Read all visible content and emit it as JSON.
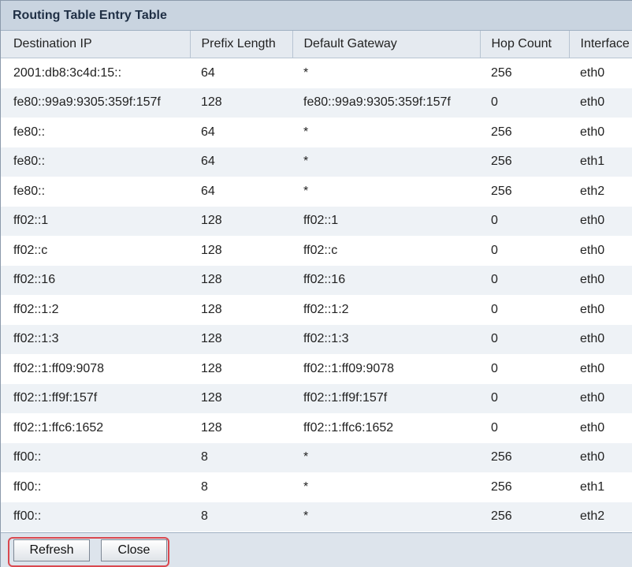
{
  "window": {
    "title": "Routing Table Entry Table"
  },
  "table": {
    "columns": [
      "Destination IP",
      "Prefix Length",
      "Default Gateway",
      "Hop Count",
      "Interface"
    ],
    "rows": [
      [
        "2001:db8:3c4d:15::",
        "64",
        "*",
        "256",
        "eth0"
      ],
      [
        "fe80::99a9:9305:359f:157f",
        "128",
        "fe80::99a9:9305:359f:157f",
        "0",
        "eth0"
      ],
      [
        "fe80::",
        "64",
        "*",
        "256",
        "eth0"
      ],
      [
        "fe80::",
        "64",
        "*",
        "256",
        "eth1"
      ],
      [
        "fe80::",
        "64",
        "*",
        "256",
        "eth2"
      ],
      [
        "ff02::1",
        "128",
        "ff02::1",
        "0",
        "eth0"
      ],
      [
        "ff02::c",
        "128",
        "ff02::c",
        "0",
        "eth0"
      ],
      [
        "ff02::16",
        "128",
        "ff02::16",
        "0",
        "eth0"
      ],
      [
        "ff02::1:2",
        "128",
        "ff02::1:2",
        "0",
        "eth0"
      ],
      [
        "ff02::1:3",
        "128",
        "ff02::1:3",
        "0",
        "eth0"
      ],
      [
        "ff02::1:ff09:9078",
        "128",
        "ff02::1:ff09:9078",
        "0",
        "eth0"
      ],
      [
        "ff02::1:ff9f:157f",
        "128",
        "ff02::1:ff9f:157f",
        "0",
        "eth0"
      ],
      [
        "ff02::1:ffc6:1652",
        "128",
        "ff02::1:ffc6:1652",
        "0",
        "eth0"
      ],
      [
        "ff00::",
        "8",
        "*",
        "256",
        "eth0"
      ],
      [
        "ff00::",
        "8",
        "*",
        "256",
        "eth1"
      ],
      [
        "ff00::",
        "8",
        "*",
        "256",
        "eth2"
      ]
    ]
  },
  "footer": {
    "refresh_label": "Refresh",
    "close_label": "Close"
  },
  "colors": {
    "title_bar": "#c9d4e0",
    "header_row": "#e5eaf0",
    "row_alt": "#eef2f6",
    "footer": "#dde4ec",
    "highlight": "#d9484f"
  }
}
